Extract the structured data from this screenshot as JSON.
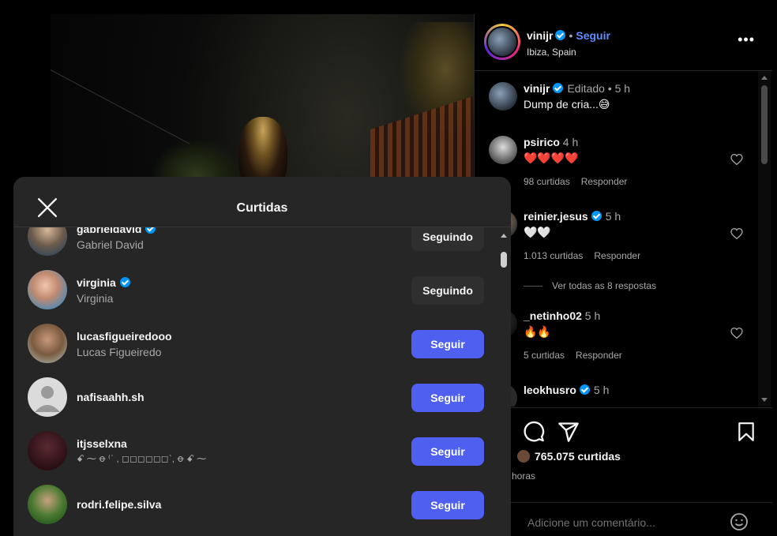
{
  "post": {
    "author": "vinijr",
    "follow_label": "Seguir",
    "separator": "•",
    "location": "Ibiza, Spain",
    "more_label": "•••"
  },
  "comments": [
    {
      "user": "vinijr",
      "time": "Editado • 5 h",
      "text": "Dump de cria...😅",
      "verified": true
    },
    {
      "user": "psirico",
      "time": "4 h",
      "text": "❤️❤️❤️❤️",
      "likes": "98 curtidas",
      "reply": "Responder"
    },
    {
      "user": "reinier.jesus",
      "time": "5 h",
      "text": "🤍🤍",
      "likes": "1.013 curtidas",
      "reply": "Responder",
      "verified": true
    },
    {
      "view_replies": "Ver todas as 8 respostas"
    },
    {
      "user": "_netinho02",
      "time": "5 h",
      "text": "🔥🔥",
      "likes": "5 curtidas",
      "reply": "Responder"
    },
    {
      "user": "leokhusro",
      "time": "5 h",
      "verified": true
    }
  ],
  "likes_summary": "765.075 curtidas",
  "time_ago": "horas",
  "comment_placeholder": "Adicione um comentário...",
  "modal": {
    "title": "Curtidas",
    "rows": [
      {
        "username": "gabrieldavid",
        "name": "Gabriel David",
        "button": "Seguindo",
        "verified": true
      },
      {
        "username": "virginia",
        "name": "Virginia",
        "button": "Seguindo",
        "verified": true
      },
      {
        "username": "lucasfigueiredooo",
        "name": "Lucas Figueiredo",
        "button": "Seguir"
      },
      {
        "username": "nafisaahh.sh",
        "name": "",
        "button": "Seguir"
      },
      {
        "username": "itjsselxna",
        "name": "ꗃ ⁓ ꝋ ⁽ˈ , ◻◻◻◻◻◻ˋ, ꝋ ꗃ ⁓",
        "button": "Seguir"
      },
      {
        "username": "rodri.felipe.silva",
        "name": "",
        "button": "Seguir"
      }
    ]
  },
  "colors": {
    "accent": "#4f5ff0",
    "verified": "#0095f6",
    "modal_bg": "#262626",
    "following_bg": "#2f2f2f"
  }
}
